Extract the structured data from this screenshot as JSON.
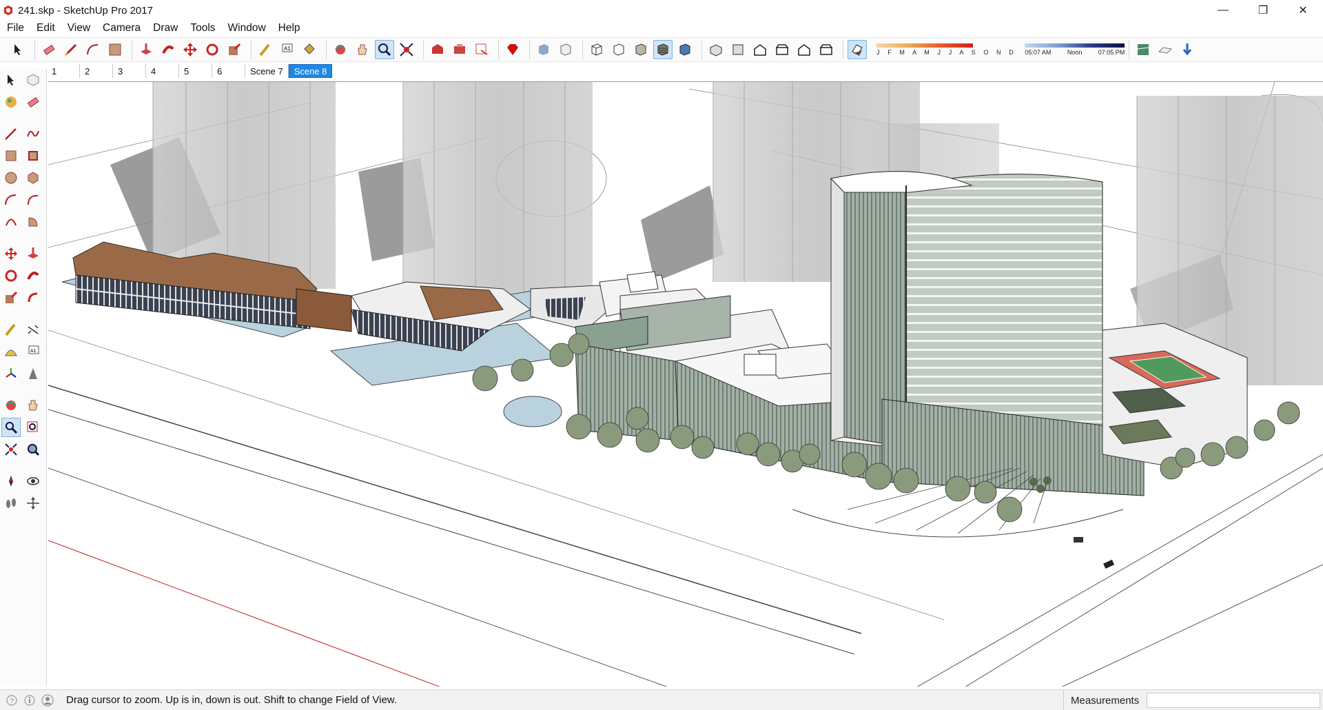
{
  "window": {
    "title": "241.skp - SketchUp Pro 2017",
    "minimize_glyph": "—",
    "maximize_glyph": "❐",
    "close_glyph": "✕"
  },
  "menu": {
    "items": [
      "File",
      "Edit",
      "View",
      "Camera",
      "Draw",
      "Tools",
      "Window",
      "Help"
    ]
  },
  "shadow": {
    "months": "J F M A M J J A S O N D",
    "time_start": "05:07 AM",
    "time_noon": "Noon",
    "time_end": "07:05 PM"
  },
  "scenes": {
    "tabs": [
      "1",
      "2",
      "3",
      "4",
      "5",
      "6",
      "Scene 7",
      "Scene 8"
    ],
    "active": "Scene 8"
  },
  "status": {
    "hint": "Drag cursor to zoom.  Up is in, down is out. Shift to change Field of View.",
    "measurements_label": "Measurements",
    "measurements_value": ""
  },
  "colors": {
    "accent": "#1e88e5",
    "roof_brown": "#9a6a48",
    "glass_green": "#7f9a86",
    "water_blue": "#b9d2de",
    "ghost_tower": "#c7c7c7",
    "tennis_green": "#4f9a5c",
    "tennis_red": "#d86a5a",
    "tree_green": "#8a9a7c"
  },
  "icons": {
    "toolbar": [
      "select-icon",
      "eraser-icon",
      "line-icon",
      "arc-icon",
      "shape-icon",
      "push-pull-icon",
      "follow-me-icon",
      "move-icon",
      "rotate-icon",
      "scale-icon",
      "tape-icon",
      "text-icon",
      "paint-icon",
      "orbit-icon",
      "pan-icon",
      "zoom-icon",
      "zoom-extents-icon",
      "warehouse-icon",
      "extension-icon",
      "send-layout-icon",
      "ruby-icon",
      "xray-icon",
      "back-edges-icon",
      "wireframe-icon",
      "hidden-line-icon",
      "shaded-icon",
      "textured-icon",
      "monochrome-icon",
      "iso-icon",
      "top-icon",
      "front-icon",
      "right-icon",
      "back-icon",
      "left-icon",
      "shadow-toggle-icon",
      "geo-location-icon",
      "sandbox-icon",
      "download-icon"
    ]
  }
}
